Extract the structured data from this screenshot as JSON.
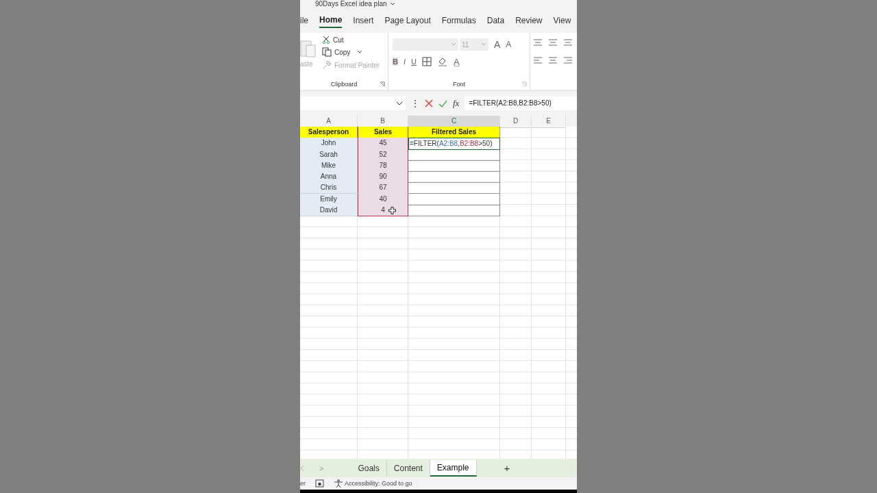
{
  "window": {
    "title": "90Days Excel idea plan"
  },
  "ribbon_tabs": [
    {
      "label": "ile",
      "selected": false
    },
    {
      "label": "Home",
      "selected": true
    },
    {
      "label": "Insert",
      "selected": false
    },
    {
      "label": "Page Layout",
      "selected": false
    },
    {
      "label": "Formulas",
      "selected": false
    },
    {
      "label": "Data",
      "selected": false
    },
    {
      "label": "Review",
      "selected": false
    },
    {
      "label": "View",
      "selected": false
    }
  ],
  "clipboard": {
    "paste": "aste",
    "cut": "Cut",
    "copy": "Copy",
    "format_painter": "Format Painter",
    "group": "Clipboard"
  },
  "font": {
    "size": "11",
    "grow": "A",
    "shrink": "A",
    "bold": "B",
    "italic": "I",
    "underline": "U",
    "font_color": "A",
    "group": "Font"
  },
  "formula_bar": {
    "more": "⋮",
    "fx": "fx",
    "formula": "=FILTER(A2:B8,B2:B8>50)"
  },
  "columns": [
    {
      "label": "A",
      "selected": false
    },
    {
      "label": "B",
      "selected": false
    },
    {
      "label": "C",
      "selected": true
    },
    {
      "label": "D",
      "selected": false
    },
    {
      "label": "E",
      "selected": false
    }
  ],
  "header": [
    "Salesperson",
    "Sales",
    "Filtered Sales"
  ],
  "rows": [
    {
      "name": "John",
      "sales": "45",
      "active": true,
      "filtered": [
        {
          "text": "=FILTER(",
          "kind": "plain"
        },
        {
          "text": "A2:B8",
          "kind": "range",
          "color": "#3b6fb6"
        },
        {
          "text": ",",
          "kind": "plain"
        },
        {
          "text": "B2:B8",
          "kind": "range",
          "color": "#b0304a"
        },
        {
          "text": ">50)",
          "kind": "plain"
        }
      ]
    },
    {
      "name": "Sarah",
      "sales": "52",
      "active": false
    },
    {
      "name": "Mike",
      "sales": "78",
      "active": false
    },
    {
      "name": "Anna",
      "sales": "90",
      "active": false
    },
    {
      "name": "Chris",
      "sales": "67",
      "active": false
    },
    {
      "name": "Emily",
      "sales": "40",
      "active": false
    },
    {
      "name": "David",
      "sales": "4",
      "active": false
    }
  ],
  "sheet_tabs": [
    {
      "label": "Goals",
      "selected": false
    },
    {
      "label": "Content",
      "selected": false
    },
    {
      "label": "Example",
      "selected": true
    }
  ],
  "sheet_nav": {
    "next": ">",
    "add": "+"
  },
  "status_bar": {
    "left": "er",
    "accessibility": "Accessibility: Good to go"
  }
}
